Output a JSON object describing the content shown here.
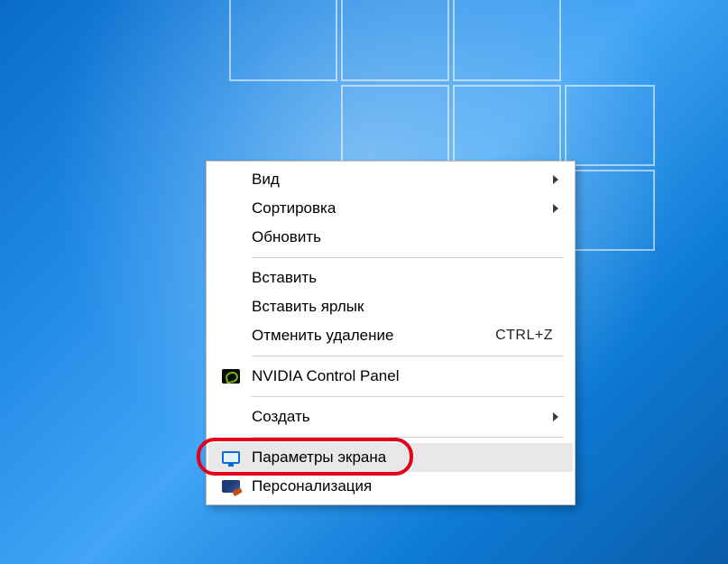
{
  "context_menu": {
    "items": [
      {
        "label": "Вид",
        "submenu": true
      },
      {
        "label": "Сортировка",
        "submenu": true
      },
      {
        "label": "Обновить"
      }
    ],
    "group2": [
      {
        "label": "Вставить"
      },
      {
        "label": "Вставить ярлык"
      },
      {
        "label": "Отменить удаление",
        "shortcut": "CTRL+Z"
      }
    ],
    "group3": [
      {
        "label": "NVIDIA Control Panel",
        "icon": "nvidia"
      }
    ],
    "group4": [
      {
        "label": "Создать",
        "submenu": true
      }
    ],
    "group5": [
      {
        "label": "Параметры экрана",
        "icon": "monitor",
        "hovered": true
      },
      {
        "label": "Персонализация",
        "icon": "personalize"
      }
    ]
  }
}
